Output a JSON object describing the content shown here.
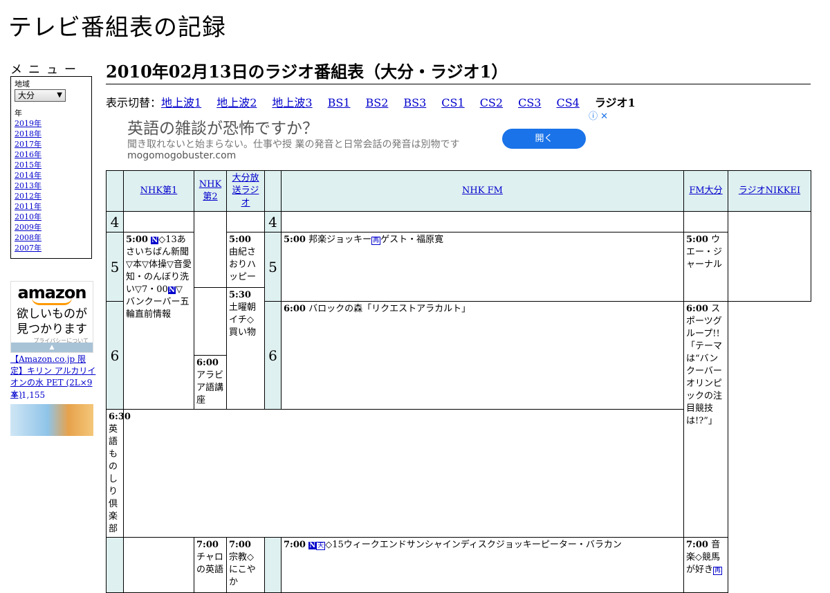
{
  "site_title": "テレビ番組表の記録",
  "menu": {
    "heading": "メニュー",
    "region_label": "地域",
    "region_value": "大分",
    "year_label": "年",
    "years": [
      "2019年",
      "2018年",
      "2017年",
      "2016年",
      "2015年",
      "2014年",
      "2013年",
      "2012年",
      "2011年",
      "2010年",
      "2009年",
      "2008年",
      "2007年"
    ]
  },
  "amazon_ad": {
    "logo": "amazon",
    "tagline_1": "欲しいものが",
    "tagline_2": "見つかります",
    "privacy": "プライバシーについて",
    "product_title": "【Amazon.co.jp 限定】キリン アルカリイオンの水 PET (2L×9本)",
    "product_price": "￥ 1,155"
  },
  "page_heading": "2010年02月13日のラジオ番組表（大分・ラジオ1）",
  "switcher": {
    "label": "表示切替：",
    "links": [
      "地上波1",
      "地上波2",
      "地上波3",
      "BS1",
      "BS2",
      "BS3",
      "CS1",
      "CS2",
      "CS3",
      "CS4"
    ],
    "current": "ラジオ1"
  },
  "banner_ad": {
    "headline": "英語の雑談が恐怖ですか？",
    "description": "聞き取れないと始まらない。仕事や授 業の発音と日常会話の発音は別物です",
    "domain": "mogomogobuster.com",
    "button": "開く",
    "info_icon": "ⓘ",
    "close_icon": "✕"
  },
  "schedule": {
    "channels": [
      "NHK第1",
      "NHK第2",
      "大分放送ラジオ",
      "NHK FM",
      "FM大分",
      "ラジオNIKKEI"
    ],
    "hours": [
      "4",
      "5",
      "6"
    ],
    "programs": {
      "nhk1_500_time": "5:00",
      "nhk1_500_text": "◇13あさいちばん新聞▽本▽体操▽音愛知・のんぼり洗い▽7・00",
      "nhk1_500_text2": "▽バンクーバー五輪直前情報",
      "nhk2_600_time": "6:00",
      "nhk2_600_text": "アラビア語講座",
      "nhk2_630_time": "6:30",
      "nhk2_630_text": "英語ものしり倶楽部",
      "nhk2_700_time": "7:00",
      "nhk2_700_text": "チャロの英語",
      "obs_500_time": "5:00",
      "obs_500_text": "由紀さおりハッピー",
      "obs_530_time": "5:30",
      "obs_530_text": "土曜朝イチ◇買い物",
      "obs_700_time": "7:00",
      "obs_700_text": "宗教◇にこやか",
      "fm_500_time": "5:00",
      "fm_500_text": "邦楽ジョッキー",
      "fm_500_text2": "ゲスト・福原寛",
      "fm_600_time": "6:00",
      "fm_600_text": "バロックの森「リクエストアラカルト」",
      "fm_700_time": "7:00",
      "fm_700_text": "◇15ウィークエンドサンシャインディスクジョッキーピーター・バラカン",
      "fmo_500_time": "5:00",
      "fmo_500_text": "ウエー・ジャーナル",
      "fmo_600_time": "6:00",
      "fmo_600_text": "スポーツグループ!!「テーマは“バンクーバーオリンピックの注目競技は!?”」",
      "nikkei_700_time": "7:00",
      "nikkei_700_text": "音楽◇競馬が好き"
    },
    "icons": {
      "news": "N",
      "weather": "天",
      "rerun": "再"
    }
  }
}
